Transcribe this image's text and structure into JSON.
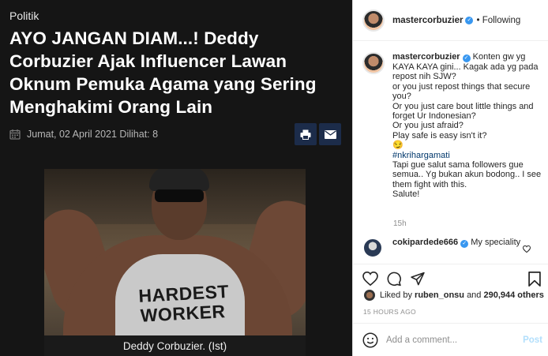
{
  "article": {
    "category": "Politik",
    "headline": "AYO JANGAN DIAM...! Deddy Corbuzier Ajak Influencer Lawan Oknum Pemuka Agama yang Sering Menghakimi Orang Lain",
    "date_text": "Jumat, 02 April 2021 Dilihat: 8",
    "photo_shirt_text": "HARDEST WORKER",
    "caption": "Deddy Corbuzier. (Ist)",
    "icons": [
      "calendar-icon",
      "print-icon",
      "mail-icon"
    ]
  },
  "instagram": {
    "header": {
      "username": "mastercorbuzier",
      "follow_status": "• Following"
    },
    "post_comment": {
      "username": "mastercorbuzier",
      "lines": [
        "Konten gw yg KAYA KAYA gini... Kagak ada yg pada repost nih SJW?",
        "or you just repost things that secure you?",
        "Or you just care bout little things and forget Ur Indonesian?",
        "Or you just afraid?",
        "Play safe is easy isn't it?",
        "😏"
      ],
      "hashtag": "#nkrihargamati",
      "closing_lines": [
        "Tapi gue salut sama followers gue semua.. Yg bukan akun bodong.. I see them fight with this.",
        "Salute!"
      ],
      "time": "15h"
    },
    "reply": {
      "username": "cokipardede666",
      "text": "My speciality"
    },
    "likes": {
      "prefix": "Liked by",
      "user": "ruben_onsu",
      "joiner": "and",
      "count": "290,944 others"
    },
    "posted_time": "15 HOURS AGO",
    "add_comment": {
      "placeholder": "Add a comment...",
      "post_label": "Post"
    },
    "colors": {
      "verified": "#3897f0",
      "post_disabled": "#b2dffc",
      "hashtag": "#00376b"
    }
  }
}
